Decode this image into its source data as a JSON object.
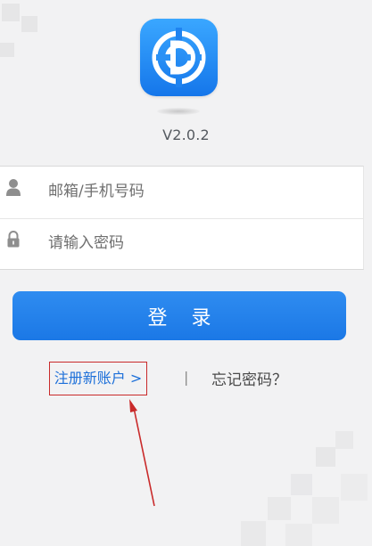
{
  "app": {
    "version": "V2.0.2",
    "accent_color": "#1b78e6",
    "logo_icon": "d-logo-icon"
  },
  "form": {
    "email": {
      "icon": "user-icon",
      "placeholder": "邮箱/手机号码"
    },
    "password": {
      "icon": "lock-icon",
      "placeholder": "请输入密码"
    }
  },
  "actions": {
    "login_label": "登 录",
    "register_label": "注册新账户 >",
    "separator": "|",
    "forgot_label": "忘记密码？"
  },
  "annotation": {
    "highlight_color": "#c92a2a",
    "arrow_icon": "red-arrow-annotation"
  }
}
